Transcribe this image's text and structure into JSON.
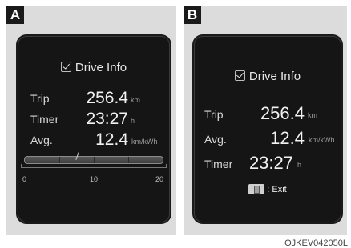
{
  "panels": {
    "a": {
      "badge": "A",
      "title": "Drive Info",
      "rows": [
        {
          "label": "Trip",
          "value": "256.4",
          "unit": "km"
        },
        {
          "label": "Timer",
          "value": "23:27",
          "unit": "h"
        },
        {
          "label": "Avg.",
          "value": "12.4",
          "unit": "km/kWh"
        }
      ],
      "gauge": {
        "min": "0",
        "mid": "10",
        "max": "20",
        "level": 0.38
      }
    },
    "b": {
      "badge": "B",
      "title": "Drive Info",
      "rows": [
        {
          "label": "Trip",
          "value": "256.4",
          "unit": "km"
        },
        {
          "label": "Avg.",
          "value": "12.4",
          "unit": "km/kWh"
        },
        {
          "label": "Timer",
          "value": "23:27",
          "unit": "h"
        }
      ],
      "exit_hint": ": Exit"
    }
  },
  "figure_code": "OJKEV042050L",
  "icons": [
    "checkbox-icon",
    "ok-button-icon"
  ]
}
